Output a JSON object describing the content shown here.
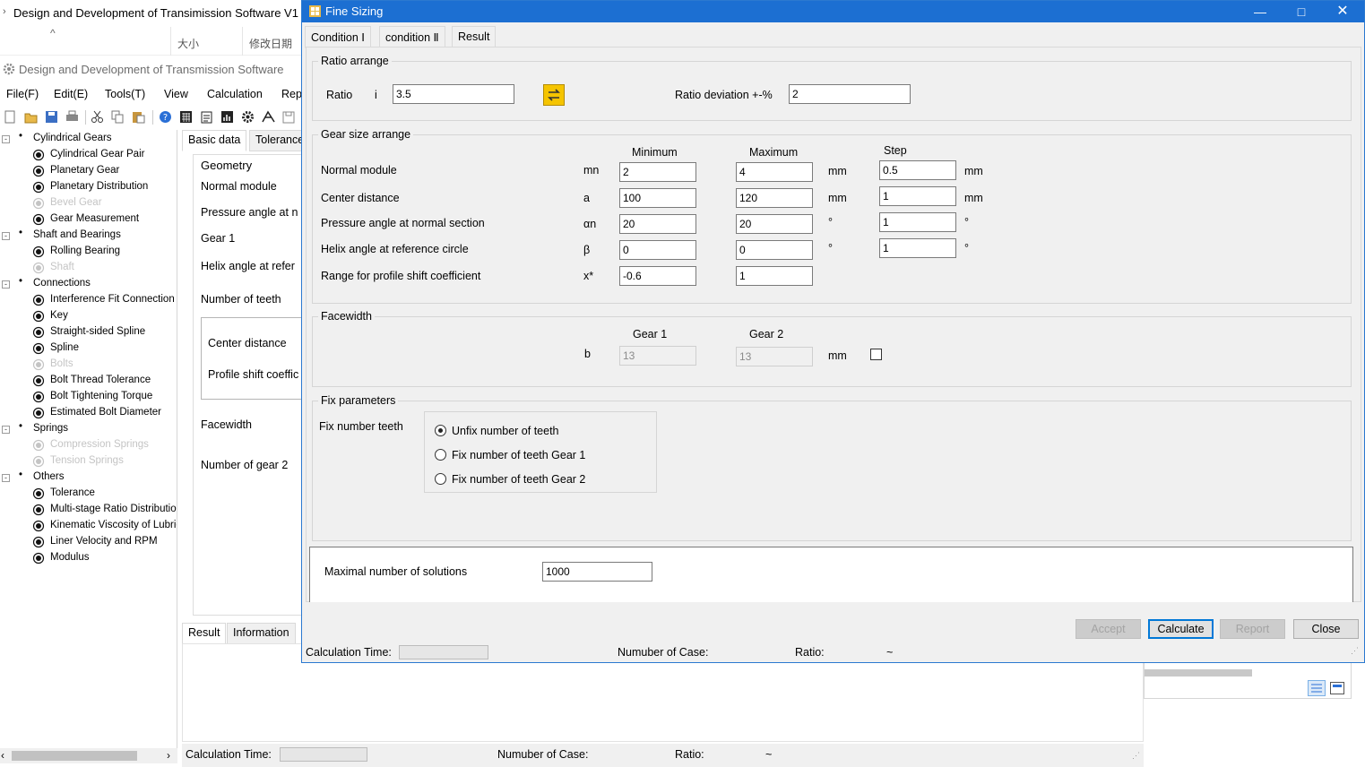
{
  "background_app": {
    "window_title": "Design and Development of Transimission Software V1",
    "explorer_cols": {
      "size": "大小",
      "modified": "修改日期"
    },
    "app_title": "Design and Development of Transmission Software",
    "menu": [
      "File(F)",
      "Edit(E)",
      "Tools(T)",
      "View",
      "Calculation",
      "Rep"
    ],
    "toolbar_icons": [
      "new-file-icon",
      "open-folder-icon",
      "save-icon",
      "print-icon",
      "cut-icon",
      "copy-icon",
      "paste-icon",
      "help-icon",
      "calculator-icon",
      "clipboard-icon",
      "chart-icon",
      "settings-gear-icon",
      "ruler-icon",
      "save-as-icon"
    ],
    "tree": [
      {
        "label": "Cylindrical Gears",
        "level": 0,
        "expand": "-",
        "dis": false
      },
      {
        "label": "Cylindrical Gear Pair",
        "level": 1,
        "dis": false
      },
      {
        "label": "Planetary Gear",
        "level": 1,
        "dis": false
      },
      {
        "label": "Planetary Distribution",
        "level": 1,
        "dis": false
      },
      {
        "label": "Bevel Gear",
        "level": 1,
        "dis": true
      },
      {
        "label": "Gear Measurement",
        "level": 1,
        "dis": false
      },
      {
        "label": "Shaft and Bearings",
        "level": 0,
        "expand": "-",
        "dis": false
      },
      {
        "label": "Rolling Bearing",
        "level": 1,
        "dis": false
      },
      {
        "label": "Shaft",
        "level": 1,
        "dis": true
      },
      {
        "label": "Connections",
        "level": 0,
        "expand": "-",
        "dis": false
      },
      {
        "label": "Interference Fit Connection",
        "level": 1,
        "dis": false
      },
      {
        "label": "Key",
        "level": 1,
        "dis": false
      },
      {
        "label": "Straight-sided Spline",
        "level": 1,
        "dis": false
      },
      {
        "label": "Spline",
        "level": 1,
        "dis": false
      },
      {
        "label": "Bolts",
        "level": 1,
        "dis": true
      },
      {
        "label": "Bolt Thread Tolerance",
        "level": 1,
        "dis": false
      },
      {
        "label": "Bolt Tightening Torque",
        "level": 1,
        "dis": false
      },
      {
        "label": "Estimated Bolt Diameter",
        "level": 1,
        "dis": false
      },
      {
        "label": "Springs",
        "level": 0,
        "expand": "-",
        "dis": false
      },
      {
        "label": "Compression Springs",
        "level": 1,
        "dis": true
      },
      {
        "label": "Tension Springs",
        "level": 1,
        "dis": true
      },
      {
        "label": "Others",
        "level": 0,
        "expand": "-",
        "dis": false
      },
      {
        "label": "Tolerance",
        "level": 1,
        "dis": false
      },
      {
        "label": "Multi-stage Ratio Distribution",
        "level": 1,
        "dis": false
      },
      {
        "label": "Kinematic Viscosity of Lubricant",
        "level": 1,
        "dis": false
      },
      {
        "label": "Liner Velocity and RPM",
        "level": 1,
        "dis": false
      },
      {
        "label": "Modulus",
        "level": 1,
        "dis": false
      }
    ],
    "main_tabs": [
      "Basic data",
      "Tolerance"
    ],
    "geometry": {
      "title": "Geometry",
      "normal_module": "Normal module",
      "pressure_angle": "Pressure angle at n",
      "gear1": "Gear 1",
      "helix_angle": "Helix angle at refer",
      "number_of_teeth": "Number of teeth",
      "center_distance": "Center distance",
      "profile_shift": "Profile shift coeffic",
      "facewidth": "Facewidth",
      "number_of_gear2": "Number of gear 2"
    },
    "result_tabs": [
      "Result",
      "Information"
    ],
    "status": {
      "calc_time": "Calculation Time:",
      "num_case": "Numuber of Case:",
      "ratio": "Ratio:",
      "tilde": "~"
    }
  },
  "dialog": {
    "title": "Fine Sizing",
    "tabs": [
      "Condition Ⅰ",
      "condition Ⅱ",
      "Result"
    ],
    "ratio_group": {
      "legend": "Ratio arrange",
      "ratio_label": "Ratio",
      "ratio_symbol": "i",
      "ratio_value": "3.5",
      "deviation_label": "Ratio deviation +-%",
      "deviation_value": "2"
    },
    "gear_size": {
      "legend": "Gear size arrange",
      "col_min": "Minimum",
      "col_max": "Maximum",
      "col_step": "Step",
      "rows": [
        {
          "label": "Normal module",
          "sym": "mn",
          "min": "2",
          "max": "4",
          "unit": "mm",
          "step": "0.5",
          "step_unit": "mm"
        },
        {
          "label": "Center distance",
          "sym": "a",
          "min": "100",
          "max": "120",
          "unit": "mm",
          "step": "1",
          "step_unit": "mm"
        },
        {
          "label": "Pressure angle at normal section",
          "sym": "αn",
          "min": "20",
          "max": "20",
          "unit": "°",
          "step": "1",
          "step_unit": "°"
        },
        {
          "label": "Helix angle at reference circle",
          "sym": "β",
          "min": "0",
          "max": "0",
          "unit": "°",
          "step": "1",
          "step_unit": "°"
        },
        {
          "label": "Range for profile shift coefficient",
          "sym": "x*",
          "min": "-0.6",
          "max": "1",
          "unit": "",
          "step": "",
          "step_unit": ""
        }
      ]
    },
    "facewidth": {
      "legend": "Facewidth",
      "gear1": "Gear 1",
      "gear2": "Gear 2",
      "sym": "b",
      "gear1_value": "13",
      "gear2_value": "13",
      "unit": "mm"
    },
    "fix_params": {
      "legend": "Fix parameters",
      "label": "Fix number teeth",
      "options": [
        "Unfix number of teeth",
        "Fix number of teeth Gear 1",
        "Fix number of teeth Gear 2"
      ],
      "selected": 0
    },
    "max_solutions": {
      "label": "Maximal number of solutions",
      "value": "1000"
    },
    "buttons": {
      "accept": "Accept",
      "calculate": "Calculate",
      "report": "Report",
      "close": "Close"
    },
    "status": {
      "calc_time": "Calculation Time:",
      "num_case": "Numuber of Case:",
      "ratio": "Ratio:",
      "tilde": "~"
    },
    "colors": {
      "title_bar": "#1c6fd2",
      "swap_button": "#f5c400",
      "default_border": "#0078d7"
    }
  }
}
